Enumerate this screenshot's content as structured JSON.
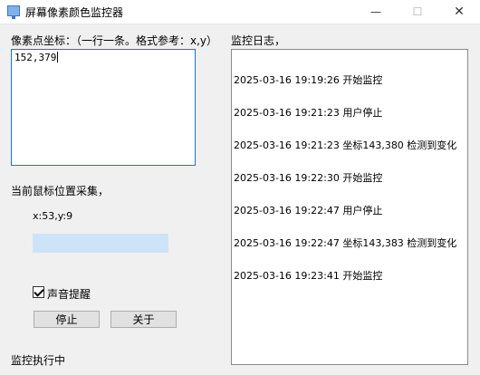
{
  "window": {
    "title": "屏幕像素颜色监控器",
    "minimize_glyph": "—",
    "maximize_glyph": "☐",
    "close_glyph": "✕"
  },
  "coords_panel": {
    "label": "像素点坐标：（一行一条。格式参考：x,y）",
    "value": "152,379"
  },
  "log_panel": {
    "label": "监控日志，",
    "lines": [
      "2025-03-16 19:19:26 开始监控",
      "2025-03-16 19:21:23 用户停止",
      "2025-03-16 19:21:23 坐标143,380 检测到变化",
      "2025-03-16 19:22:30 开始监控",
      "2025-03-16 19:22:47 用户停止",
      "2025-03-16 19:22:47 坐标143,383 检测到变化",
      "2025-03-16 19:23:41 开始监控"
    ]
  },
  "capture": {
    "label": "当前鼠标位置采集，",
    "position_text": "x:53,y:9",
    "color": "#cde4f8"
  },
  "sound_alert": {
    "label": "声音提醒",
    "checked": true
  },
  "buttons": {
    "stop": "停止",
    "about": "关于"
  },
  "status": {
    "text": "监控执行中"
  }
}
